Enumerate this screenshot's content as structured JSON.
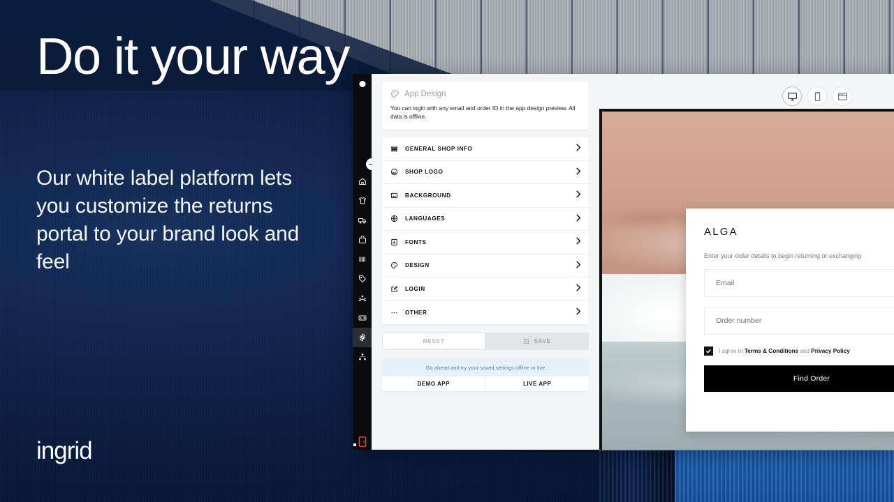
{
  "marketing": {
    "headline": "Do it your way",
    "subcopy": "Our white label platform lets you customize the returns portal to your brand look and feel",
    "logo": "ingrid"
  },
  "sidebar": {
    "items": [
      {
        "name": "home-icon",
        "label": "Home"
      },
      {
        "name": "tshirt-icon",
        "label": "Products"
      },
      {
        "name": "truck-icon",
        "label": "Shipping"
      },
      {
        "name": "bag-icon",
        "label": "Orders"
      },
      {
        "name": "barcode-icon",
        "label": "Barcodes"
      },
      {
        "name": "tag-icon",
        "label": "Labels"
      },
      {
        "name": "people-icon",
        "label": "Customers"
      },
      {
        "name": "card-icon",
        "label": "Billing"
      },
      {
        "name": "gear-icon",
        "label": "Settings"
      },
      {
        "name": "org-chart-icon",
        "label": "Organisation"
      }
    ],
    "active_index": 8,
    "expand_label": "Expand menu",
    "logout_label": "Log out"
  },
  "settings": {
    "info_card": {
      "title": "App Design",
      "icon": "palette-icon",
      "body": "You can login with any email and order ID in the app design preview. All data is offline."
    },
    "menu": [
      {
        "label": "GENERAL SHOP INFO",
        "icon": "store-icon"
      },
      {
        "label": "SHOP LOGO",
        "icon": "image-logo-icon"
      },
      {
        "label": "BACKGROUND",
        "icon": "picture-icon"
      },
      {
        "label": "LANGUAGES",
        "icon": "globe-icon"
      },
      {
        "label": "FONTS",
        "icon": "font-book-icon"
      },
      {
        "label": "DESIGN",
        "icon": "palette-icon"
      },
      {
        "label": "LOGIN",
        "icon": "login-edit-icon"
      },
      {
        "label": "OTHER",
        "icon": "ellipsis-icon"
      }
    ],
    "actions": {
      "reset_label": "RESET",
      "save_label": "SAVE",
      "save_icon": "save-disk-icon"
    },
    "try": {
      "note": "Go ahead and try your saved settings offline or live",
      "demo_label": "DEMO APP",
      "live_label": "LIVE APP"
    }
  },
  "preview": {
    "devices": [
      {
        "name": "desktop-view",
        "label": "Desktop",
        "active": true
      },
      {
        "name": "mobile-view",
        "label": "Mobile",
        "active": false
      },
      {
        "name": "browser-view",
        "label": "Browser",
        "active": false
      }
    ],
    "portal": {
      "brand": "ALGA",
      "subtitle": "Enter your order details to begin returning or exchanging",
      "email_placeholder": "Email",
      "order_placeholder": "Order number",
      "terms_prefix": "I agree to ",
      "terms_link": "Terms & Conditions",
      "terms_middle": " and ",
      "privacy_link": "Privacy Policy",
      "cta_label": "Find Order",
      "checkbox_checked": true
    }
  },
  "colors": {
    "navy": "#0b1c3d",
    "accent_blue": "#1a5fb4",
    "panel_bg": "#f4f5f7",
    "cta_black": "#000000",
    "note_bg": "#e6f2fb",
    "note_text": "#5b7fa8"
  }
}
